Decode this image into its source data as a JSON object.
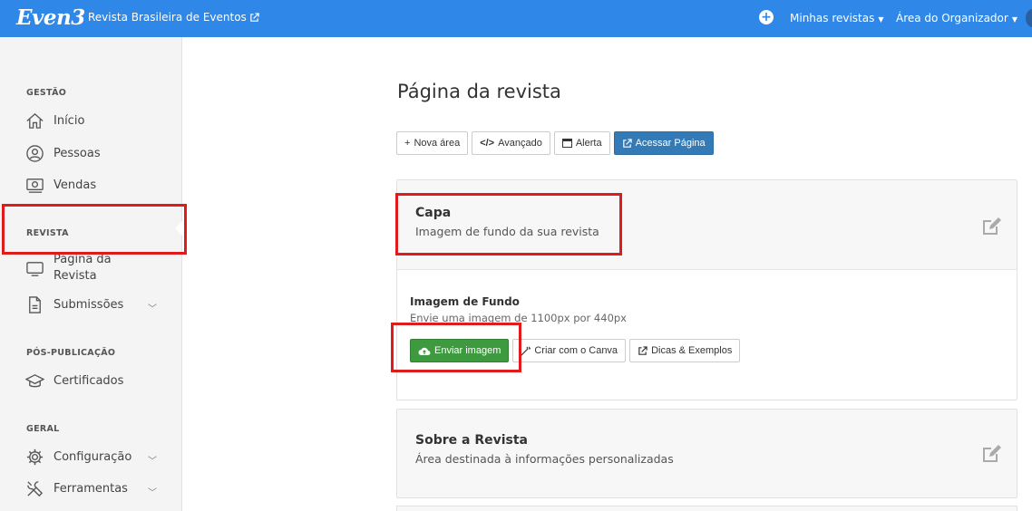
{
  "topbar": {
    "logo": "Even3",
    "event_name": "Revista Brasileira de Eventos",
    "menu_revistas": "Minhas revistas",
    "menu_organizador": "Área do Organizador"
  },
  "sidebar": {
    "sections": {
      "gestao": "GESTÃO",
      "revista": "REVISTA",
      "pos": "PÓS-PUBLICAÇÃO",
      "geral": "GERAL"
    },
    "items": {
      "inicio": "Início",
      "pessoas": "Pessoas",
      "vendas": "Vendas",
      "pagina_l1": "Página da",
      "pagina_l2": "Revista",
      "submissoes": "Submissões",
      "certificados": "Certificados",
      "configuracao": "Configuração",
      "ferramentas": "Ferramentas"
    }
  },
  "main": {
    "title": "Página da revista",
    "toolbar": {
      "nova_area": "Nova área",
      "avancado": "Avançado",
      "alerta": "Alerta",
      "acessar": "Acessar Página"
    },
    "capa": {
      "title": "Capa",
      "subtitle": "Imagem de fundo da sua revista",
      "image_title": "Imagem de Fundo",
      "image_hint": "Envie uma imagem de 1100px por 440px",
      "btn_enviar": "Enviar imagem",
      "btn_canva": "Criar com o Canva",
      "btn_dicas": "Dicas & Exemplos"
    },
    "sobre": {
      "title": "Sobre a Revista",
      "subtitle": "Área destinada à informações personalizadas"
    }
  },
  "colors": {
    "topbar": "#2f87e8",
    "primary_button": "#337ab7",
    "success_button": "#3e9a3e",
    "highlight": "#e01b1b"
  }
}
